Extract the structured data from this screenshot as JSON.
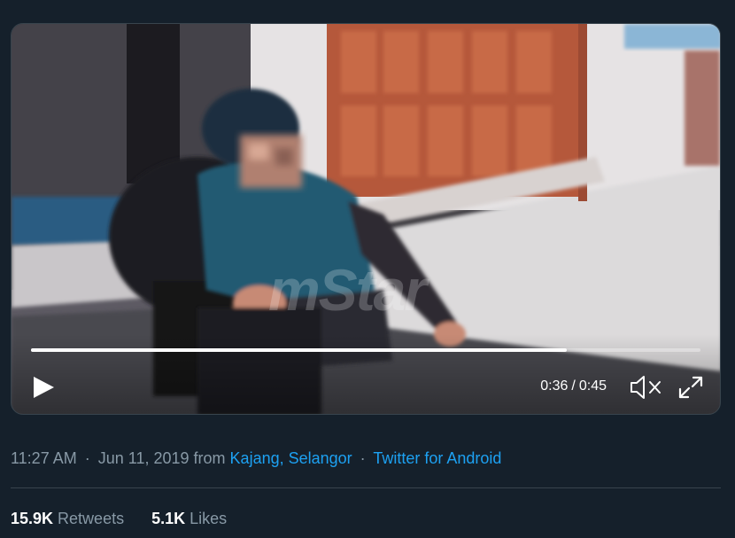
{
  "video": {
    "watermark": "mStar",
    "elapsed": "0:36",
    "separator": "/",
    "duration": "0:45",
    "progress_fraction": 0.8,
    "controls": {
      "play": "play-icon",
      "mute": "speaker-muted-icon",
      "fullscreen": "expand-icon"
    }
  },
  "tweet": {
    "time": "11:27 AM",
    "date": "Jun 11, 2019",
    "from_word": "from",
    "location": "Kajang, Selangor",
    "source": "Twitter for Android",
    "separator": "·"
  },
  "stats": {
    "retweets_count": "15.9K",
    "retweets_label": "Retweets",
    "likes_count": "5.1K",
    "likes_label": "Likes"
  },
  "colors": {
    "background": "#15202b",
    "link": "#1da1f2",
    "muted_text": "#8899a6",
    "divider": "#38444d",
    "primary_text": "#ffffff"
  }
}
